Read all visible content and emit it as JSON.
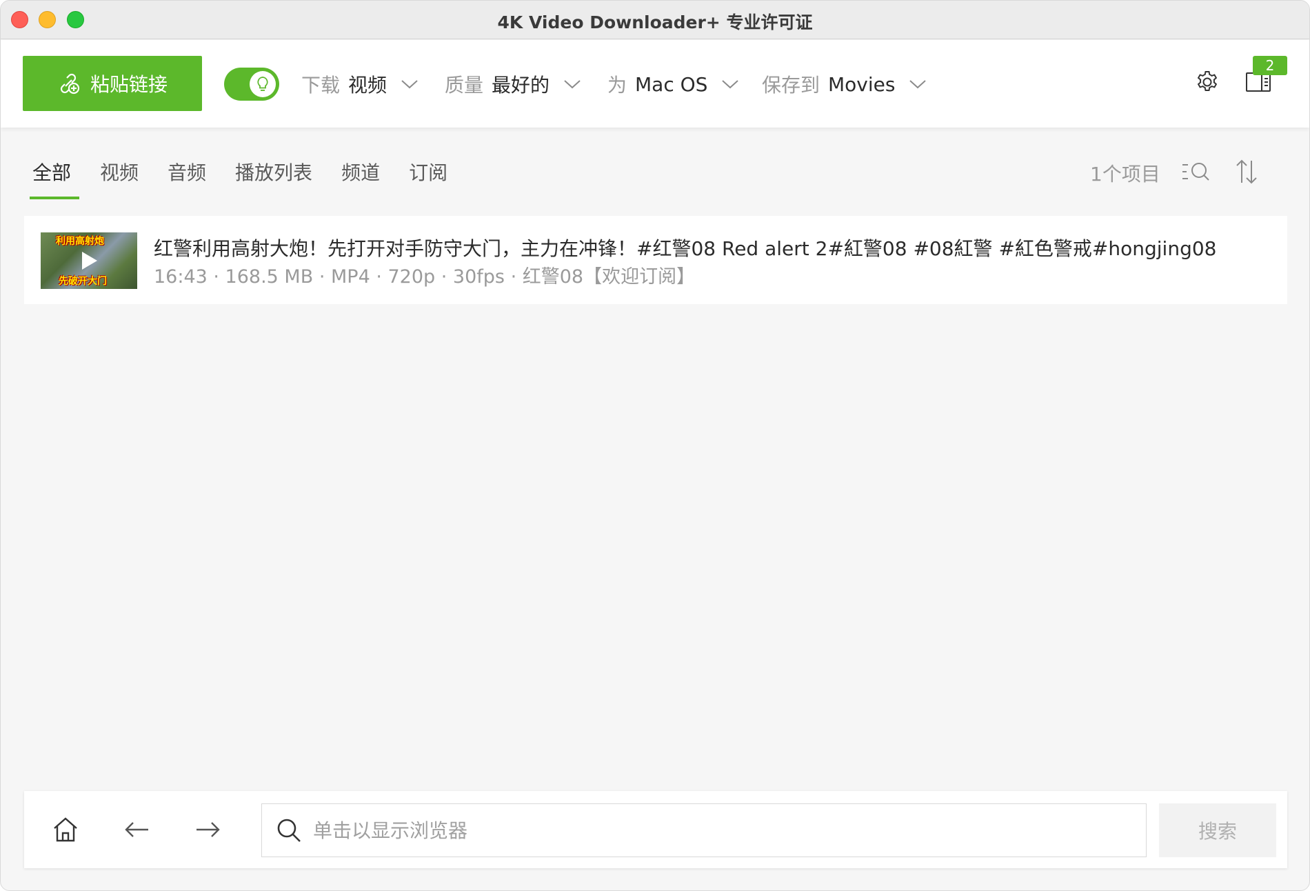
{
  "window": {
    "title": "4K Video Downloader+ 专业许可证"
  },
  "toolbar": {
    "paste_label": "粘贴链接",
    "download": {
      "label": "下载",
      "value": "视频"
    },
    "quality": {
      "label": "质量",
      "value": "最好的"
    },
    "platform": {
      "label": "为",
      "value": "Mac OS"
    },
    "save_to": {
      "label": "保存到",
      "value": "Movies"
    },
    "badge_count": "2"
  },
  "tabs": [
    {
      "label": "全部",
      "active": true
    },
    {
      "label": "视频"
    },
    {
      "label": "音频"
    },
    {
      "label": "播放列表"
    },
    {
      "label": "频道"
    },
    {
      "label": "订阅"
    }
  ],
  "list_count": "1个项目",
  "items": [
    {
      "title": "红警利用高射大炮！先打开对手防守大门，主力在冲锋！#红警08  Red alert 2#紅警08 #08紅警 #紅色警戒#hongjing08",
      "meta": "16:43 · 168.5 MB · MP4 · 720p · 30fps · 红警08【欢迎订阅】",
      "thumb_text_top": "利用高射炮",
      "thumb_text_bottom": "先破开大门"
    }
  ],
  "bottom": {
    "search_placeholder": "单击以显示浏览器",
    "search_button": "搜索"
  },
  "colors": {
    "accent": "#5cb82b"
  }
}
